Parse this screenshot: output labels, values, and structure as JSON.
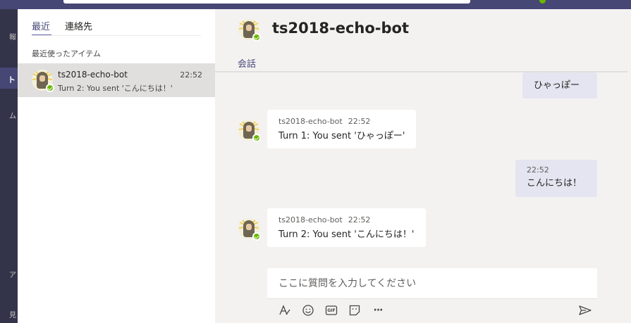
{
  "rail": {
    "labels": [
      "報",
      "ト",
      "ム",
      "ア",
      "見"
    ]
  },
  "chatlist": {
    "tabs": [
      {
        "label": "最近"
      },
      {
        "label": "連絡先"
      }
    ],
    "section_title": "最近使ったアイテム",
    "items": [
      {
        "name": "ts2018-echo-bot",
        "time": "22:52",
        "preview": "Turn 2: You sent 'こんにちは！'"
      }
    ]
  },
  "conversation": {
    "title": "ts2018-echo-bot",
    "tab_label": "会話",
    "messages": [
      {
        "from": "me",
        "time": "",
        "text": "ひゃっぽー"
      },
      {
        "from": "bot",
        "sender": "ts2018-echo-bot",
        "time": "22:52",
        "text": "Turn 1: You sent 'ひゃっぽー'"
      },
      {
        "from": "me",
        "time": "22:52",
        "text": "こんにちは！"
      },
      {
        "from": "bot",
        "sender": "ts2018-echo-bot",
        "time": "22:52",
        "text": "Turn 2: You sent 'こんにちは！'"
      }
    ]
  },
  "compose": {
    "placeholder": "ここに質問を入力してください"
  },
  "toolbar": {
    "icons": [
      "format-icon",
      "emoji-icon",
      "gif-icon",
      "sticker-icon",
      "more-icon",
      "send-icon"
    ],
    "gif_label": "GIF",
    "more_label": "···"
  },
  "colors": {
    "accent": "#6264a7",
    "topbar": "#464775",
    "rail": "#33344a",
    "presence": "#6bb700",
    "my_bubble": "#e5e5f1"
  }
}
